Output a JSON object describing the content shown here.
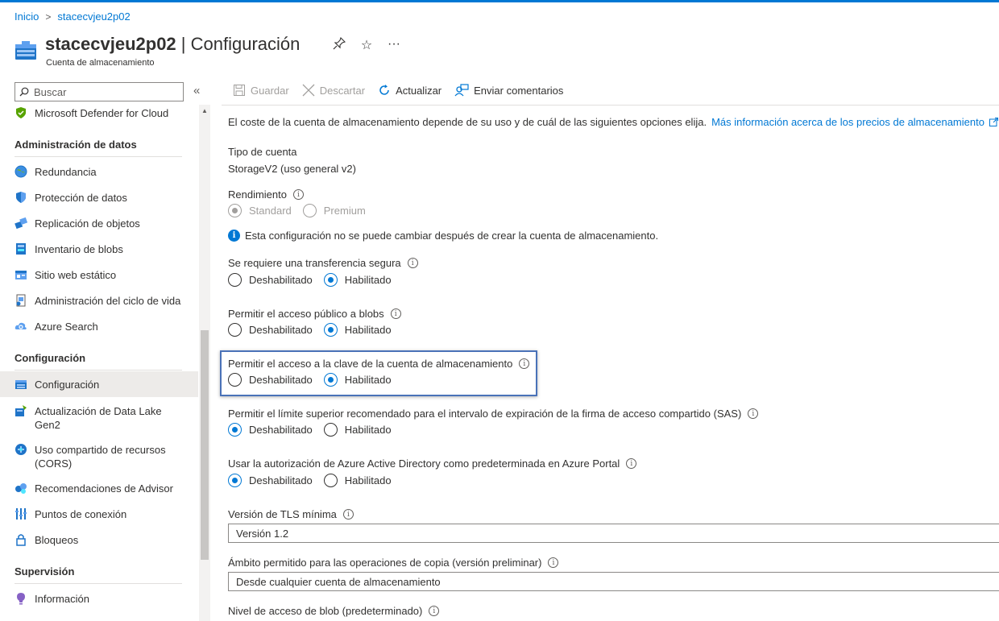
{
  "breadcrumb": {
    "home": "Inicio",
    "resource": "stacecvjeu2p02"
  },
  "header": {
    "resource_name": "stacecvjeu2p02",
    "separator": " | ",
    "page_title": "Configuración",
    "subtitle": "Cuenta de almacenamiento"
  },
  "search": {
    "placeholder": "Buscar"
  },
  "sidebar": {
    "items_top": [
      {
        "label": "Microsoft Defender for Cloud",
        "icon": "shield-green-icon"
      }
    ],
    "section_data": "Administración de datos",
    "data_items": [
      {
        "label": "Redundancia",
        "icon": "globe-icon"
      },
      {
        "label": "Protección de datos",
        "icon": "shield-icon"
      },
      {
        "label": "Replicación de objetos",
        "icon": "replication-icon"
      },
      {
        "label": "Inventario de blobs",
        "icon": "inventory-icon"
      },
      {
        "label": "Sitio web estático",
        "icon": "website-icon"
      },
      {
        "label": "Administración del ciclo de vida",
        "icon": "lifecycle-icon"
      },
      {
        "label": "Azure Search",
        "icon": "cloud-search-icon"
      }
    ],
    "section_config": "Configuración",
    "config_items": [
      {
        "label": "Configuración",
        "icon": "config-icon"
      },
      {
        "label": "Actualización de Data Lake Gen2",
        "icon": "datalake-icon"
      },
      {
        "label": "Uso compartido de recursos (CORS)",
        "icon": "cors-icon"
      },
      {
        "label": "Recomendaciones de Advisor",
        "icon": "advisor-icon"
      },
      {
        "label": "Puntos de conexión",
        "icon": "endpoints-icon"
      },
      {
        "label": "Bloqueos",
        "icon": "lock-icon"
      }
    ],
    "section_monitor": "Supervisión",
    "monitor_items": [
      {
        "label": "Información",
        "icon": "insights-icon"
      }
    ]
  },
  "toolbar": {
    "save": "Guardar",
    "discard": "Descartar",
    "refresh": "Actualizar",
    "feedback": "Enviar comentarios"
  },
  "content": {
    "intro": "El coste de la cuenta de almacenamiento depende de su uso y de cuál de las siguientes opciones elija.",
    "intro_link": "Más información acerca de los precios de almacenamiento",
    "account_type_label": "Tipo de cuenta",
    "account_type_value": "StorageV2 (uso general v2)",
    "performance_label": "Rendimiento",
    "performance_options": [
      "Standard",
      "Premium"
    ],
    "performance_selected": "Standard",
    "performance_notice": "Esta configuración no se puede cambiar después de crear la cuenta de almacenamiento.",
    "secure_transfer_label": "Se requiere una transferencia segura",
    "public_blob_label": "Permitir el acceso público a blobs",
    "key_access_label": "Permitir el acceso a la clave de la cuenta de almacenamiento",
    "sas_label": "Permitir el límite superior recomendado para el intervalo de expiración de la firma de acceso compartido (SAS)",
    "aad_label": "Usar la autorización de Azure Active Directory como predeterminada en Azure Portal",
    "disabled": "Deshabilitado",
    "enabled": "Habilitado",
    "secure_transfer_selected": "Habilitado",
    "public_blob_selected": "Habilitado",
    "key_access_selected": "Habilitado",
    "sas_selected": "Deshabilitado",
    "aad_selected": "Deshabilitado",
    "tls_label": "Versión de TLS mínima",
    "tls_value": "Versión 1.2",
    "copy_scope_label": "Ámbito permitido para las operaciones de copia (versión preliminar)",
    "copy_scope_value": "Desde cualquier cuenta de almacenamiento",
    "blob_tier_label": "Nivel de acceso de blob (predeterminado)"
  },
  "colors": {
    "accent": "#0078d4",
    "highlight_border": "#4a72b8"
  }
}
